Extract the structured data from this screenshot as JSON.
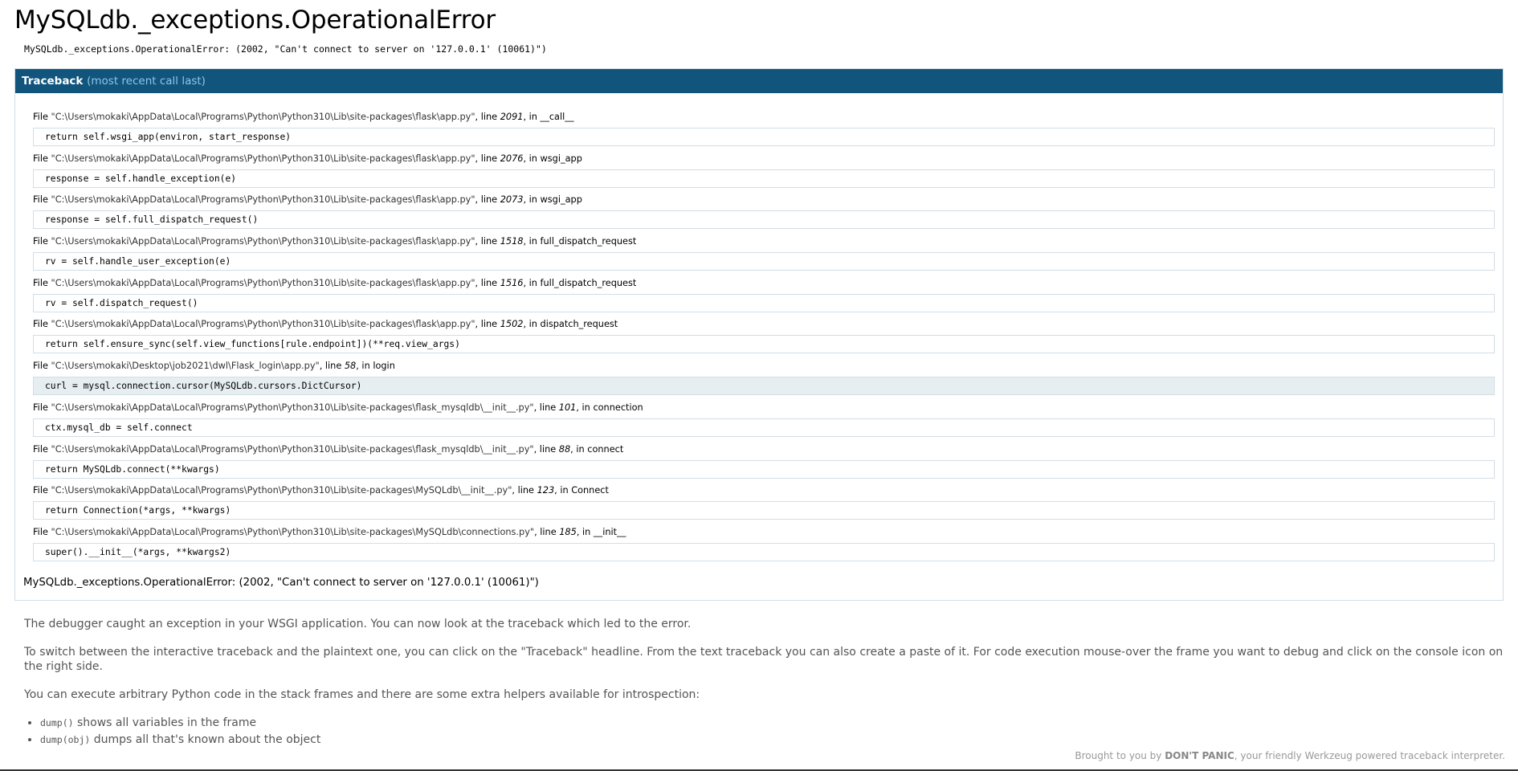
{
  "title": "MySQLdb._exceptions.OperationalError",
  "error_message": "MySQLdb._exceptions.OperationalError: (2002, \"Can't connect to server on '127.0.0.1' (10061)\")",
  "traceback": {
    "header_label": "Traceback",
    "header_sub": "(most recent call last)",
    "frames": [
      {
        "file_prefix": "File ",
        "file": "\"C:\\Users\\mokaki\\AppData\\Local\\Programs\\Python\\Python310\\Lib\\site-packages\\flask\\app.py\"",
        "line_prefix": ", line ",
        "line": "2091",
        "in_prefix": ", in ",
        "func": "__call__",
        "code": "return self.wsgi_app(environ, start_response)",
        "highlight": false
      },
      {
        "file_prefix": "File ",
        "file": "\"C:\\Users\\mokaki\\AppData\\Local\\Programs\\Python\\Python310\\Lib\\site-packages\\flask\\app.py\"",
        "line_prefix": ", line ",
        "line": "2076",
        "in_prefix": ", in ",
        "func": "wsgi_app",
        "code": "response = self.handle_exception(e)",
        "highlight": false
      },
      {
        "file_prefix": "File ",
        "file": "\"C:\\Users\\mokaki\\AppData\\Local\\Programs\\Python\\Python310\\Lib\\site-packages\\flask\\app.py\"",
        "line_prefix": ", line ",
        "line": "2073",
        "in_prefix": ", in ",
        "func": "wsgi_app",
        "code": "response = self.full_dispatch_request()",
        "highlight": false
      },
      {
        "file_prefix": "File ",
        "file": "\"C:\\Users\\mokaki\\AppData\\Local\\Programs\\Python\\Python310\\Lib\\site-packages\\flask\\app.py\"",
        "line_prefix": ", line ",
        "line": "1518",
        "in_prefix": ", in ",
        "func": "full_dispatch_request",
        "code": "rv = self.handle_user_exception(e)",
        "highlight": false
      },
      {
        "file_prefix": "File ",
        "file": "\"C:\\Users\\mokaki\\AppData\\Local\\Programs\\Python\\Python310\\Lib\\site-packages\\flask\\app.py\"",
        "line_prefix": ", line ",
        "line": "1516",
        "in_prefix": ", in ",
        "func": "full_dispatch_request",
        "code": "rv = self.dispatch_request()",
        "highlight": false
      },
      {
        "file_prefix": "File ",
        "file": "\"C:\\Users\\mokaki\\AppData\\Local\\Programs\\Python\\Python310\\Lib\\site-packages\\flask\\app.py\"",
        "line_prefix": ", line ",
        "line": "1502",
        "in_prefix": ", in ",
        "func": "dispatch_request",
        "code": "return self.ensure_sync(self.view_functions[rule.endpoint])(**req.view_args)",
        "highlight": false
      },
      {
        "file_prefix": "File ",
        "file": "\"C:\\Users\\mokaki\\Desktop\\job2021\\dwl\\Flask_login\\app.py\"",
        "line_prefix": ", line ",
        "line": "58",
        "in_prefix": ", in ",
        "func": "login",
        "code": "curl = mysql.connection.cursor(MySQLdb.cursors.DictCursor)",
        "highlight": true
      },
      {
        "file_prefix": "File ",
        "file": "\"C:\\Users\\mokaki\\AppData\\Local\\Programs\\Python\\Python310\\Lib\\site-packages\\flask_mysqldb\\__init__.py\"",
        "line_prefix": ", line ",
        "line": "101",
        "in_prefix": ", in ",
        "func": "connection",
        "code": "ctx.mysql_db = self.connect",
        "highlight": false
      },
      {
        "file_prefix": "File ",
        "file": "\"C:\\Users\\mokaki\\AppData\\Local\\Programs\\Python\\Python310\\Lib\\site-packages\\flask_mysqldb\\__init__.py\"",
        "line_prefix": ", line ",
        "line": "88",
        "in_prefix": ", in ",
        "func": "connect",
        "code": "return MySQLdb.connect(**kwargs)",
        "highlight": false
      },
      {
        "file_prefix": "File ",
        "file": "\"C:\\Users\\mokaki\\AppData\\Local\\Programs\\Python\\Python310\\Lib\\site-packages\\MySQLdb\\__init__.py\"",
        "line_prefix": ", line ",
        "line": "123",
        "in_prefix": ", in ",
        "func": "Connect",
        "code": "return Connection(*args, **kwargs)",
        "highlight": false
      },
      {
        "file_prefix": "File ",
        "file": "\"C:\\Users\\mokaki\\AppData\\Local\\Programs\\Python\\Python310\\Lib\\site-packages\\MySQLdb\\connections.py\"",
        "line_prefix": ", line ",
        "line": "185",
        "in_prefix": ", in ",
        "func": "__init__",
        "code": "super().__init__(*args, **kwargs2)",
        "highlight": false
      }
    ],
    "final_error": "MySQLdb._exceptions.OperationalError: (2002, \"Can't connect to server on '127.0.0.1' (10061)\")"
  },
  "explanation": {
    "p1": "The debugger caught an exception in your WSGI application. You can now look at the traceback which led to the error.",
    "p2": "To switch between the interactive traceback and the plaintext one, you can click on the \"Traceback\" headline. From the text traceback you can also create a paste of it. For code execution mouse-over the frame you want to debug and click on the console icon on the right side.",
    "p3": "You can execute arbitrary Python code in the stack frames and there are some extra helpers available for introspection:",
    "helpers": [
      {
        "code": "dump()",
        "text": " shows all variables in the frame"
      },
      {
        "code": "dump(obj)",
        "text": " dumps all that's known about the object"
      }
    ]
  },
  "footer": {
    "prefix": "Brought to you by ",
    "brand": "DON'T PANIC",
    "suffix": ", your friendly Werkzeug powered traceback interpreter."
  }
}
